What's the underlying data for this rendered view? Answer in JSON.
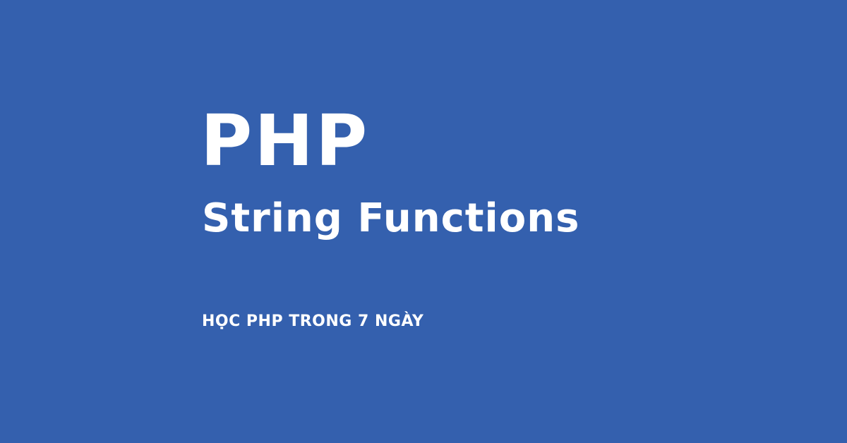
{
  "banner": {
    "title": "PHP",
    "subtitle": "String Functions",
    "tagline": "HỌC PHP TRONG 7 NGÀY",
    "background_color": "#3460ae",
    "text_color": "#ffffff"
  }
}
